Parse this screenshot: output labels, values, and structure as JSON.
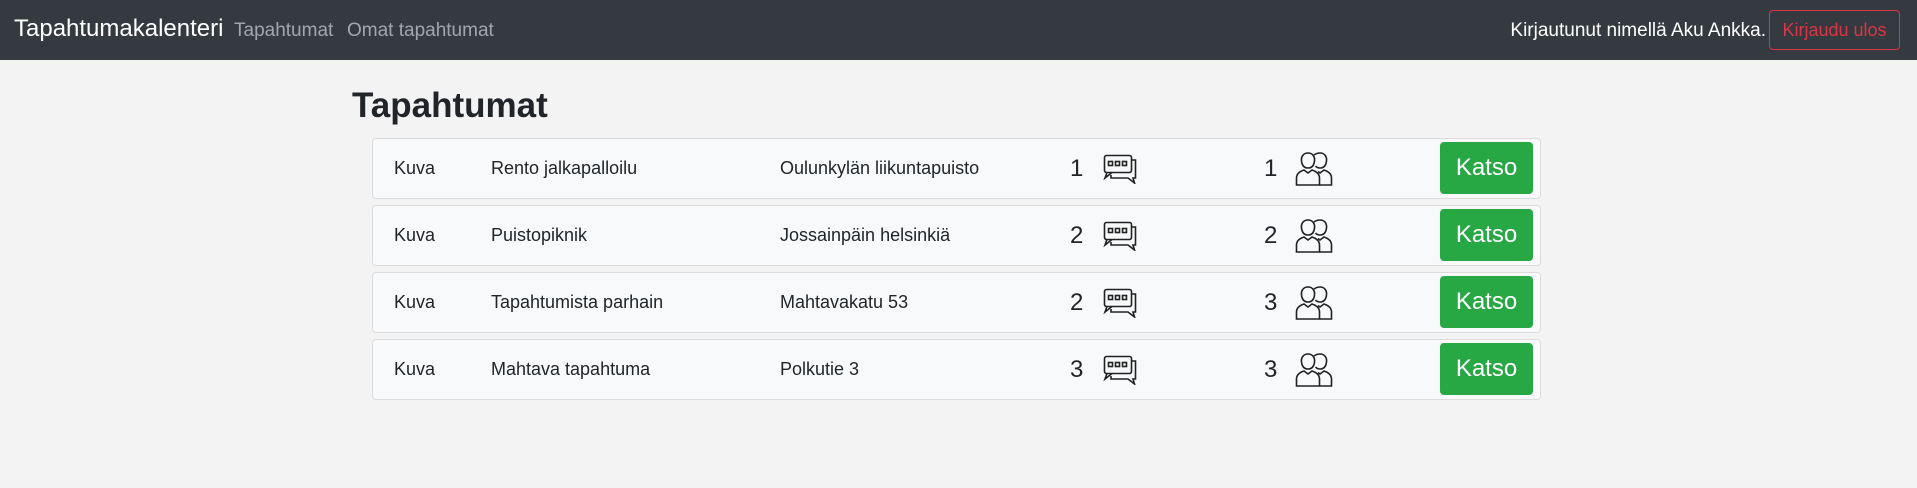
{
  "navbar": {
    "brand": "Tapahtumakalenteri",
    "links": [
      "Tapahtumat",
      "Omat tapahtumat"
    ],
    "logged_in_text": "Kirjautunut nimellä Aku Ankka.",
    "logout_label": "Kirjaudu ulos"
  },
  "page": {
    "title": "Tapahtumat"
  },
  "events": [
    {
      "image": "Kuva",
      "name": "Rento jalkapalloilu",
      "place": "Oulunkylän liikuntapuisto",
      "comments": "1",
      "participants": "1",
      "button": "Katso"
    },
    {
      "image": "Kuva",
      "name": "Puistopiknik",
      "place": "Jossainpäin helsinkiä",
      "comments": "2",
      "participants": "2",
      "button": "Katso"
    },
    {
      "image": "Kuva",
      "name": "Tapahtumista parhain",
      "place": "Mahtavakatu 53",
      "comments": "2",
      "participants": "3",
      "button": "Katso"
    },
    {
      "image": "Kuva",
      "name": "Mahtava tapahtuma",
      "place": "Polkutie 3",
      "comments": "3",
      "participants": "3",
      "button": "Katso"
    }
  ],
  "icons": {
    "comments": "comment-bubbles-icon",
    "participants": "people-icon"
  },
  "colors": {
    "navbar": "#343a40",
    "success": "#28a745",
    "danger": "#dc3545",
    "background": "#f3f3f3"
  }
}
